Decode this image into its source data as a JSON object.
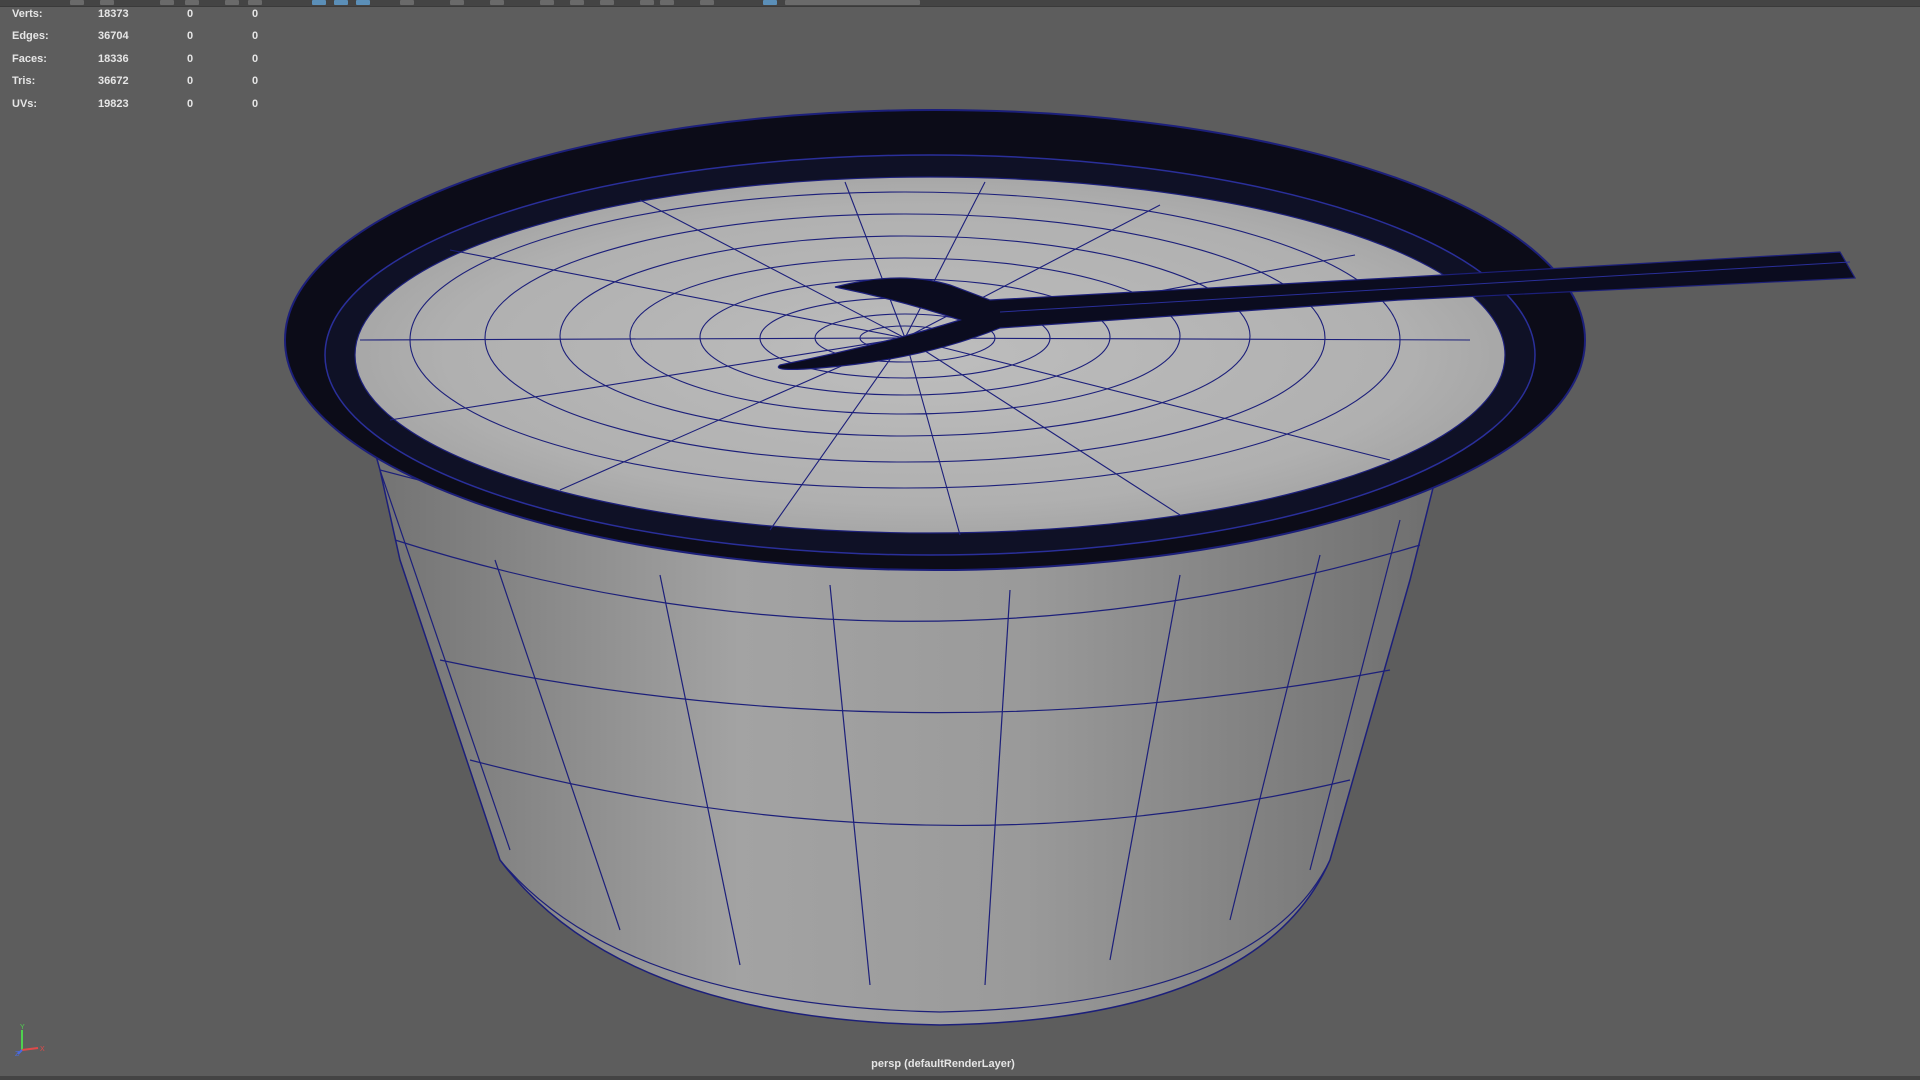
{
  "hud": {
    "rows": [
      {
        "label": "Verts:",
        "v1": "18373",
        "v2": "0",
        "v3": "0"
      },
      {
        "label": "Edges:",
        "v1": "36704",
        "v2": "0",
        "v3": "0"
      },
      {
        "label": "Faces:",
        "v1": "18336",
        "v2": "0",
        "v3": "0"
      },
      {
        "label": "Tris:",
        "v1": "36672",
        "v2": "0",
        "v3": "0"
      },
      {
        "label": "UVs:",
        "v1": "19823",
        "v2": "0",
        "v3": "0"
      }
    ]
  },
  "viewport": {
    "camera_label": "persp (defaultRenderLayer)",
    "background_color": "#5d5d5d",
    "wire_color": "#1c1f7a"
  },
  "axis_gizmo": {
    "x": "X",
    "y": "Y",
    "z": "Z"
  }
}
